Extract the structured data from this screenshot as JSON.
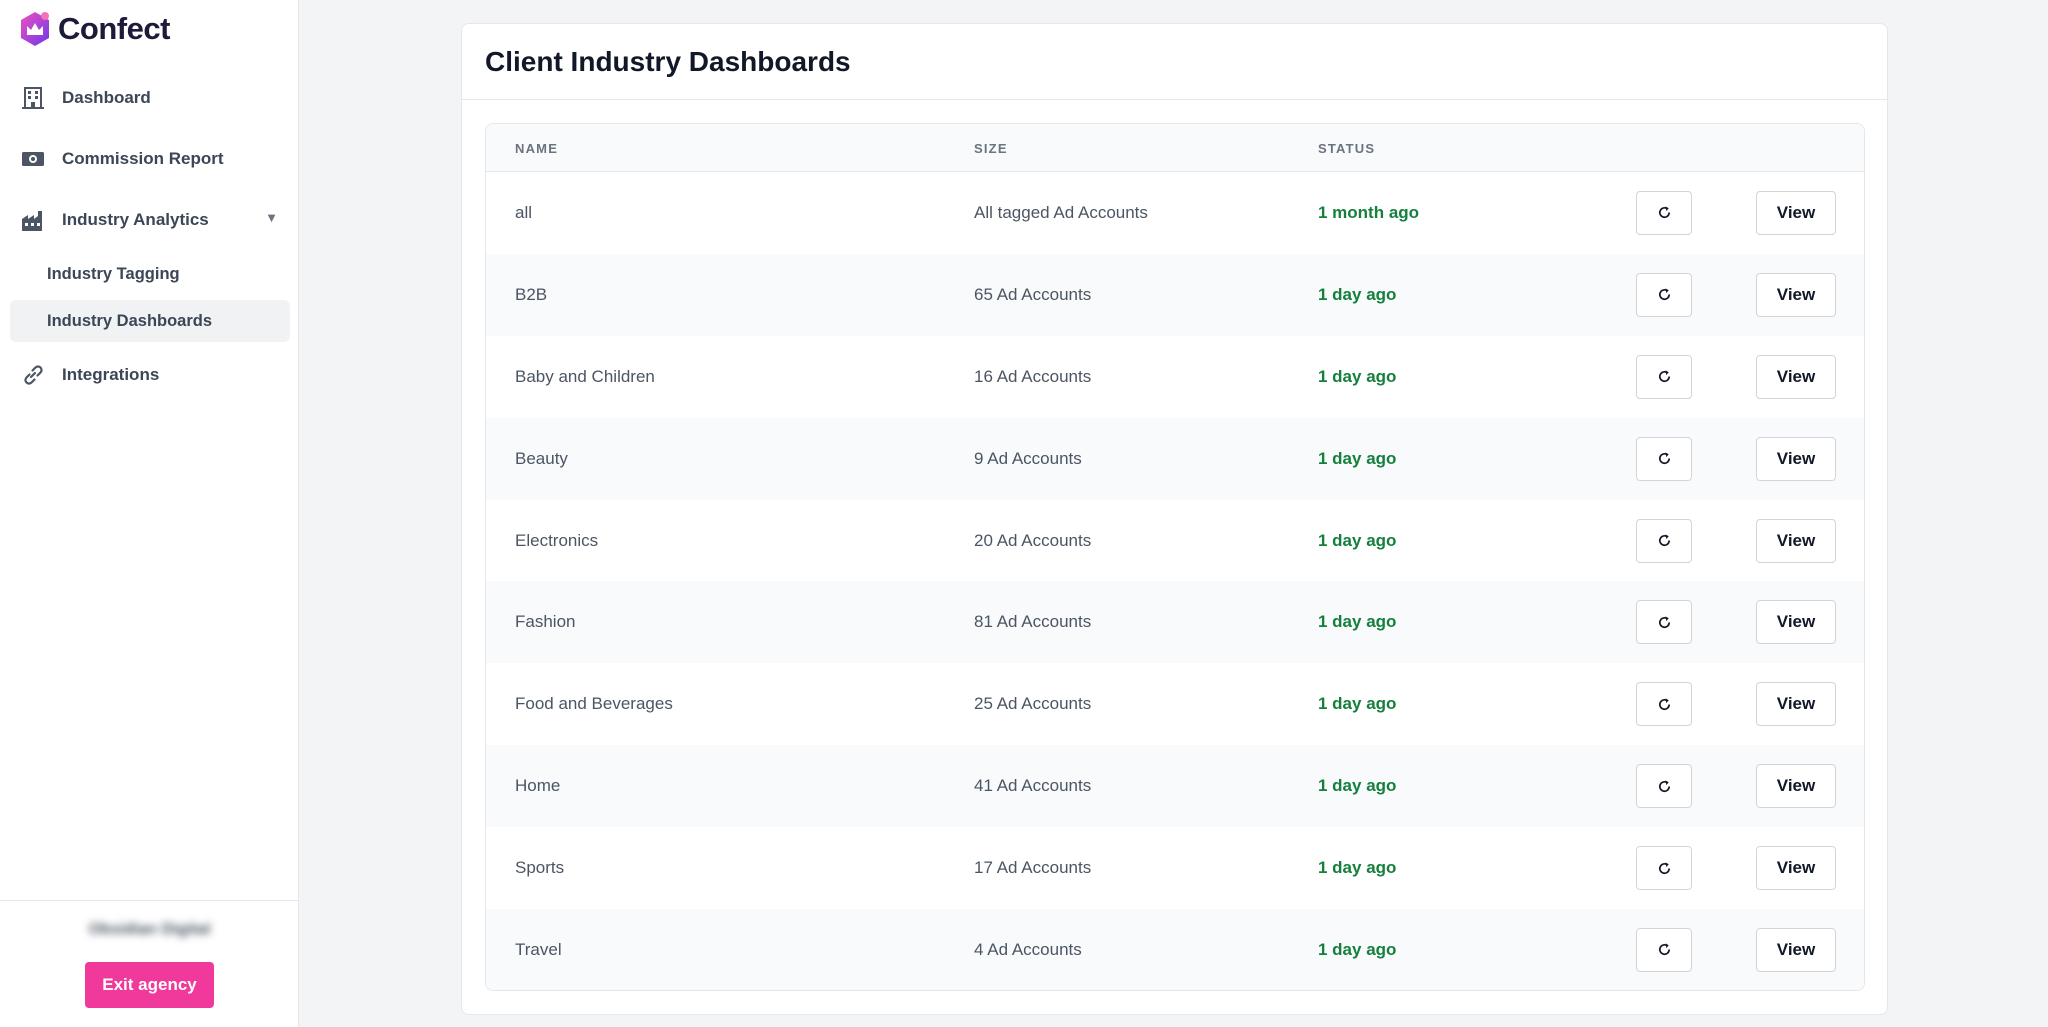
{
  "app": {
    "name": "Confect"
  },
  "sidebar": {
    "items": [
      {
        "label": "Dashboard",
        "icon": "building-icon"
      },
      {
        "label": "Commission Report",
        "icon": "cash-icon"
      },
      {
        "label": "Industry Analytics",
        "icon": "factory-icon"
      },
      {
        "label": "Industry Tagging"
      },
      {
        "label": "Industry Dashboards"
      },
      {
        "label": "Integrations",
        "icon": "link-icon"
      }
    ],
    "agency_name": "Obsidian Digital",
    "exit_label": "Exit agency"
  },
  "main": {
    "title": "Client Industry Dashboards",
    "columns": [
      "NAME",
      "SIZE",
      "STATUS"
    ],
    "rows": [
      {
        "name": "all",
        "size": "All tagged Ad Accounts",
        "status": "1 month ago"
      },
      {
        "name": "B2B",
        "size": "65 Ad Accounts",
        "status": "1 day ago"
      },
      {
        "name": "Baby and Children",
        "size": "16 Ad Accounts",
        "status": "1 day ago"
      },
      {
        "name": "Beauty",
        "size": "9 Ad Accounts",
        "status": "1 day ago"
      },
      {
        "name": "Electronics",
        "size": "20 Ad Accounts",
        "status": "1 day ago"
      },
      {
        "name": "Fashion",
        "size": "81 Ad Accounts",
        "status": "1 day ago"
      },
      {
        "name": "Food and Beverages",
        "size": "25 Ad Accounts",
        "status": "1 day ago"
      },
      {
        "name": "Home",
        "size": "41 Ad Accounts",
        "status": "1 day ago"
      },
      {
        "name": "Sports",
        "size": "17 Ad Accounts",
        "status": "1 day ago"
      },
      {
        "name": "Travel",
        "size": "4 Ad Accounts",
        "status": "1 day ago"
      }
    ],
    "view_label": "View"
  },
  "colors": {
    "accent": "#f0399a",
    "status_green": "#15803d",
    "logo_purple": "#7c3aed"
  }
}
